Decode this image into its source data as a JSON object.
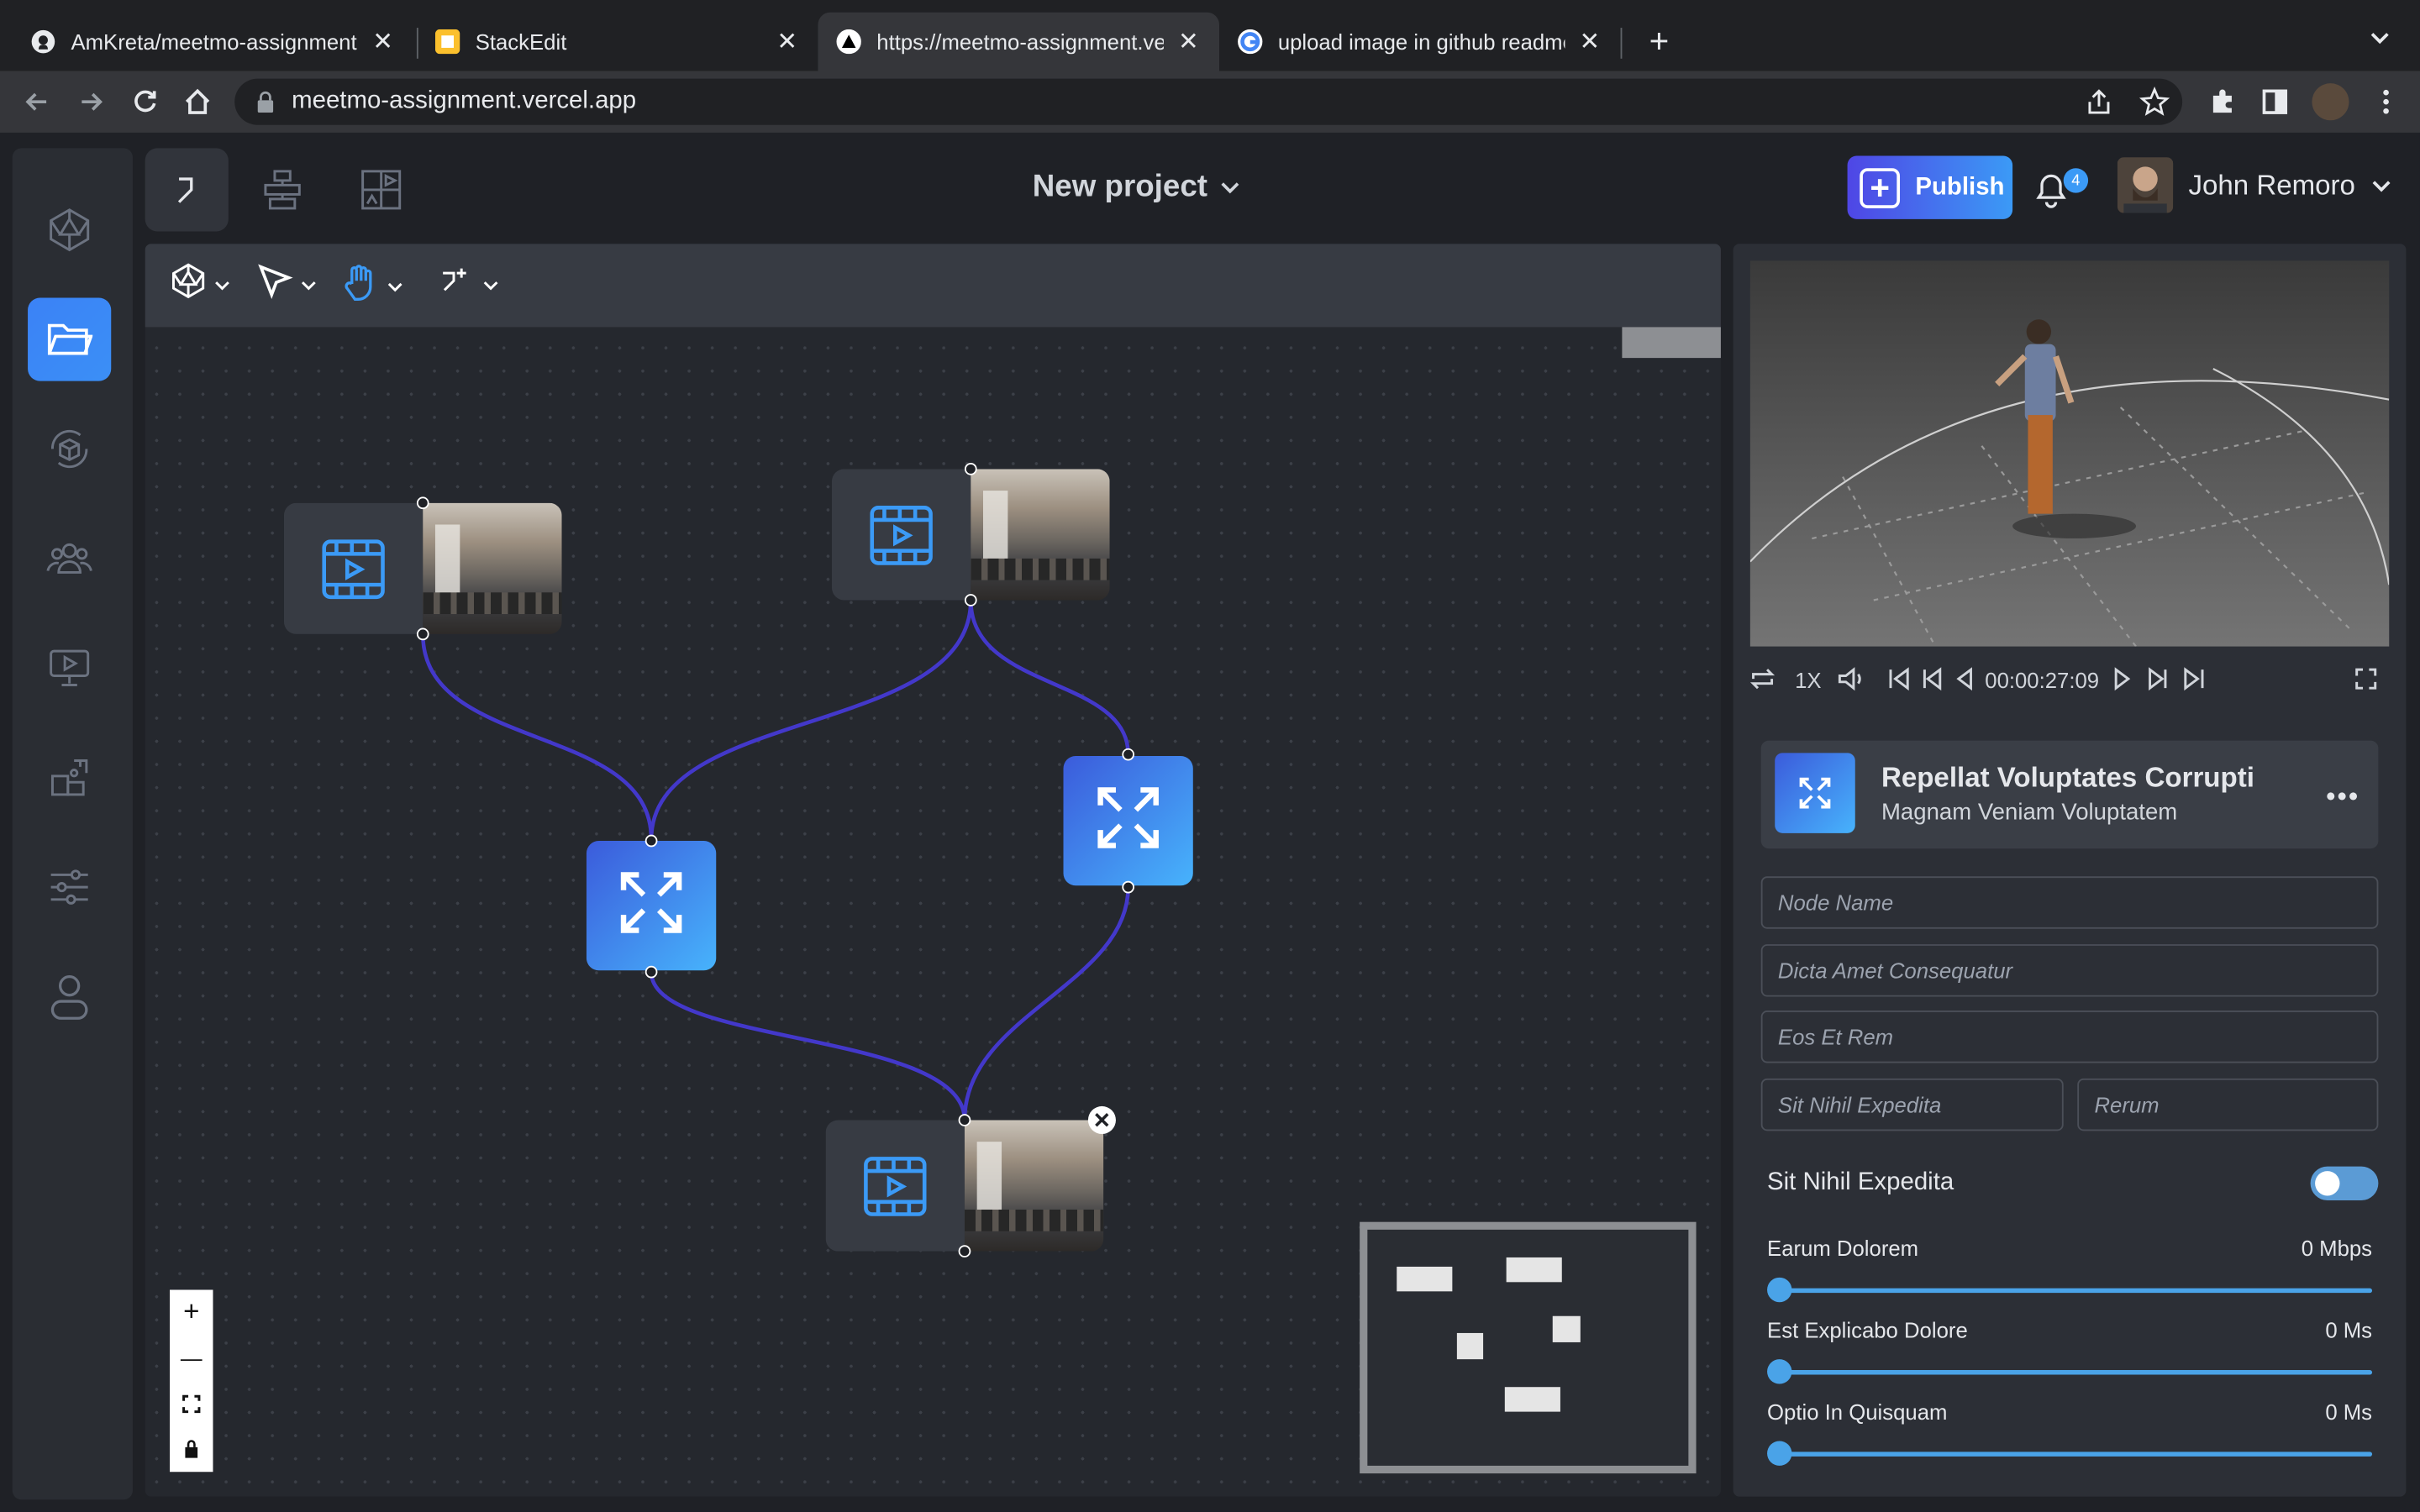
{
  "browser": {
    "tabs": [
      {
        "title": "AmKreta/meetmo-assignment:",
        "icon": "github-icon"
      },
      {
        "title": "StackEdit",
        "icon": "stackedit-icon"
      },
      {
        "title": "https://meetmo-assignment.ve",
        "icon": "vercel-icon"
      },
      {
        "title": "upload image in github readme",
        "icon": "google-icon"
      }
    ],
    "close_glyph": "✕",
    "new_tab_glyph": "+",
    "url": "meetmo-assignment.vercel.app"
  },
  "app": {
    "project_title": "New project",
    "publish_label": "Publish",
    "publish_plus": "+",
    "notification_count": "4",
    "user_name": "John Remoro",
    "left_rail_icons": [
      "network-icon",
      "folder-icon",
      "cube-sync-icon",
      "users-icon",
      "presentation-icon",
      "puzzle-icon",
      "sliders-icon",
      "user-icon"
    ],
    "top_tools": [
      "flow-icon",
      "hierarchy-icon",
      "media-grid-icon"
    ],
    "canvas_tools": [
      "network-icon",
      "pointer-icon",
      "hand-icon",
      "add-connection-icon"
    ],
    "zoom_controls": [
      "+",
      "—",
      "⛶",
      "🔒"
    ],
    "delete_glyph": "✕"
  },
  "player": {
    "speed": "1X",
    "timecode": "00:00:27:09"
  },
  "node_card": {
    "title": "Repellat Voluptates Corrupti",
    "subtitle": "Magnam Veniam Voluptatem",
    "menu": "•••"
  },
  "form": {
    "node_name_placeholder": "Node Name",
    "field2_placeholder": "Dicta Amet Consequatur",
    "field3_placeholder": "Eos Et Rem",
    "field4_placeholder": "Sit Nihil Expedita",
    "field5_placeholder": "Rerum",
    "toggle_label": "Sit Nihil Expedita",
    "toggle_on": false,
    "sliders": [
      {
        "label": "Earum Dolorem",
        "value": "0 Mbps",
        "level": 0
      },
      {
        "label": "Est Explicabo Dolore",
        "value": "0 Ms",
        "level": 0
      },
      {
        "label": "Optio In Quisquam",
        "value": "0 Ms",
        "level": 0
      }
    ]
  },
  "colors": {
    "accent": "#3b82f6",
    "edge": "#4338ca",
    "panel": "#2c2f36"
  }
}
